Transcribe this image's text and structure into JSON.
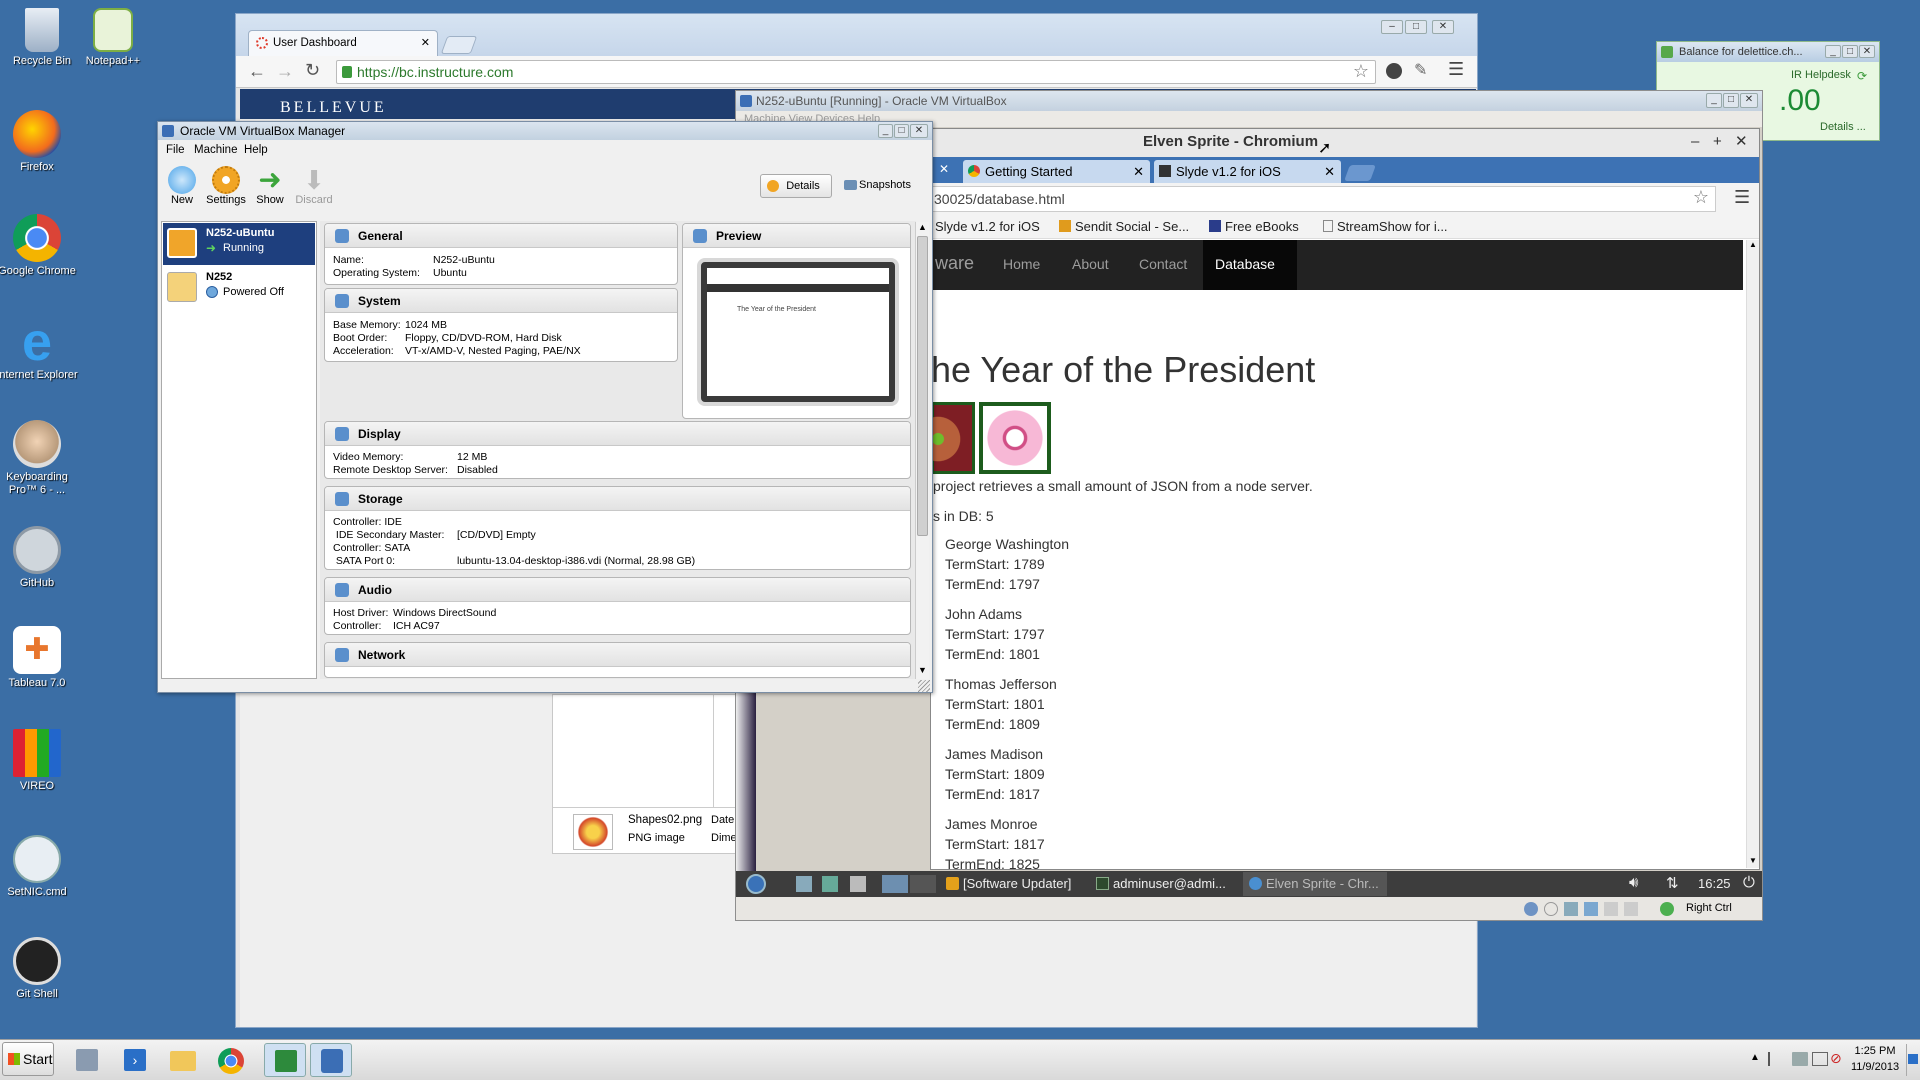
{
  "desktop": {
    "icons": [
      {
        "label": "Recycle Bin",
        "icon": "recycle-bin-icon"
      },
      {
        "label": "Notepad++",
        "icon": "notepad-icon"
      },
      {
        "label": "Firefox",
        "icon": "firefox-icon"
      },
      {
        "label": "Google Chrome",
        "icon": "chrome-icon"
      },
      {
        "label": "Internet Explorer",
        "icon": "ie-icon"
      },
      {
        "label": "Keyboarding Pro™ 6 - ...",
        "icon": "keyboarding-icon"
      },
      {
        "label": "GitHub",
        "icon": "github-icon"
      },
      {
        "label": "Tableau 7.0",
        "icon": "tableau-icon"
      },
      {
        "label": "VIREO",
        "icon": "vireo-icon"
      },
      {
        "label": "SetNIC.cmd",
        "icon": "setnic-icon"
      },
      {
        "label": "Git Shell",
        "icon": "git-shell-icon"
      }
    ]
  },
  "balance_widget": {
    "title": "Balance for delettice.ch...",
    "link": "IR Helpdesk",
    "amount": ".00",
    "details": "Details ..."
  },
  "browser": {
    "tab_title": "User Dashboard",
    "url": "https://bc.instructure.com",
    "header_text": "BELLEVUE"
  },
  "vm_window": {
    "title": "N252-uBuntu [Running] - Oracle VM VirtualBox",
    "menu_fragment": "Machine  View  Devices  Help",
    "status_right": "Right Ctrl"
  },
  "chromium": {
    "title": "Elven Sprite - Chromium",
    "tabs": [
      "Getting Started",
      "Slyde v1.2 for iOS"
    ],
    "url": "30025/database.html",
    "bookmarks": [
      "Slyde v1.2 for iOS",
      "Sendit Social - Se...",
      "Free eBooks",
      "StreamShow for i..."
    ],
    "nav": {
      "brand": "ware",
      "items": [
        "Home",
        "About",
        "Contact",
        "Database"
      ]
    },
    "heading": "he Year of the President",
    "description": "project retrieves a small amount of JSON from a node server.",
    "count_text": "s in DB: 5",
    "presidents": [
      {
        "name": "George Washington",
        "start": "TermStart: 1789",
        "end": "TermEnd: 1797"
      },
      {
        "name": "John Adams",
        "start": "TermStart: 1797",
        "end": "TermEnd: 1801"
      },
      {
        "name": "Thomas Jefferson",
        "start": "TermStart: 1801",
        "end": "TermEnd: 1809"
      },
      {
        "name": "James Madison",
        "start": "TermStart: 1809",
        "end": "TermEnd: 1817"
      },
      {
        "name": "James Monroe",
        "start": "TermStart: 1817",
        "end": "TermEnd: 1825"
      }
    ]
  },
  "guest_taskbar": {
    "items": [
      "[Software Updater]",
      "adminuser@admi...",
      "Elven Sprite - Chr..."
    ],
    "clock": "16:25"
  },
  "file_item": {
    "name": "Shapes02.png",
    "type": "PNG image",
    "col1": "Date",
    "col2": "Dime"
  },
  "vbox_manager": {
    "title": "Oracle VM VirtualBox Manager",
    "menu": [
      "File",
      "Machine",
      "Help"
    ],
    "toolbar": [
      "New",
      "Settings",
      "Show",
      "Discard"
    ],
    "details_button": "Details",
    "snapshots_button": "Snapshots",
    "vms": [
      {
        "name": "N252-uBuntu",
        "state": "Running"
      },
      {
        "name": "N252",
        "state": "Powered Off"
      }
    ],
    "sections": {
      "general": {
        "title": "General",
        "rows": [
          [
            "Name:",
            "N252-uBuntu"
          ],
          [
            "Operating System:",
            "Ubuntu"
          ]
        ]
      },
      "system": {
        "title": "System",
        "rows": [
          [
            "Base Memory:",
            "1024 MB"
          ],
          [
            "Boot Order:",
            "Floppy, CD/DVD-ROM, Hard Disk"
          ],
          [
            "Acceleration:",
            "VT-x/AMD-V, Nested Paging, PAE/NX"
          ]
        ]
      },
      "preview": {
        "title": "Preview",
        "inner_title": "The Year of the President"
      },
      "display": {
        "title": "Display",
        "rows": [
          [
            "Video Memory:",
            "12 MB"
          ],
          [
            "Remote Desktop Server:",
            "Disabled"
          ]
        ]
      },
      "storage": {
        "title": "Storage",
        "rows": [
          [
            "Controller: IDE",
            ""
          ],
          [
            " IDE Secondary Master:",
            "[CD/DVD] Empty"
          ],
          [
            "Controller: SATA",
            ""
          ],
          [
            " SATA Port 0:",
            "lubuntu-13.04-desktop-i386.vdi (Normal, 28.98 GB)"
          ]
        ]
      },
      "audio": {
        "title": "Audio",
        "rows": [
          [
            "Host Driver:",
            "Windows DirectSound"
          ],
          [
            "Controller:",
            "ICH AC97"
          ]
        ]
      },
      "network": {
        "title": "Network"
      }
    }
  },
  "taskbar": {
    "start": "Start",
    "time": "1:25 PM",
    "date": "11/9/2013"
  }
}
